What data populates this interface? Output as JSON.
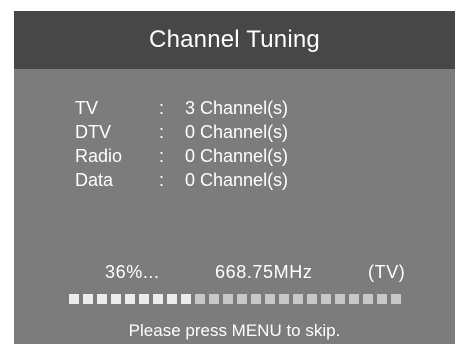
{
  "screen": {
    "title": "Channel Tuning"
  },
  "counts": [
    {
      "label": "TV",
      "sep": ":",
      "value": "3 Channel(s)"
    },
    {
      "label": "DTV",
      "sep": ":",
      "value": "0 Channel(s)"
    },
    {
      "label": "Radio",
      "sep": ":",
      "value": "0 Channel(s)"
    },
    {
      "label": "Data",
      "sep": ":",
      "value": "0 Channel(s)"
    }
  ],
  "status": {
    "percent_text": "36%...",
    "frequency": "668.75MHz",
    "signal_type": "(TV)"
  },
  "progress": {
    "segments": 24,
    "fraction": 0.36
  },
  "hint": "Please press MENU to skip.",
  "colors": {
    "panel": "#7c7c7c",
    "title_bar": "#474747",
    "text": "#ffffff",
    "progress_segment": "#c8c8c8"
  }
}
